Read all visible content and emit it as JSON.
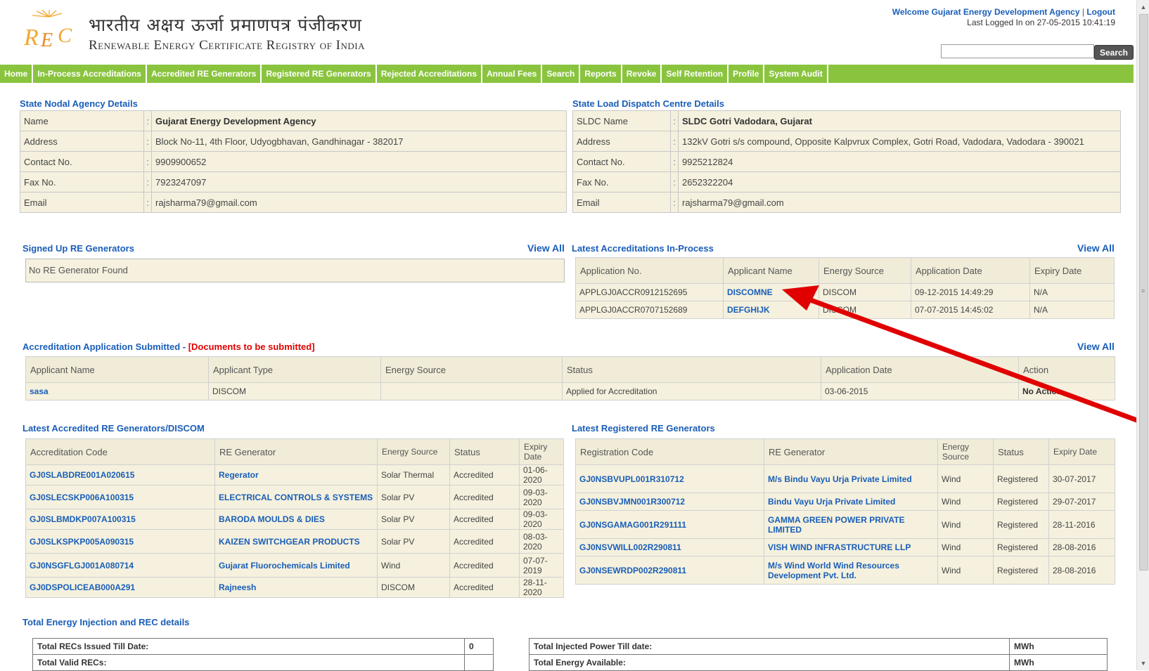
{
  "header": {
    "title_hi": "भारतीय अक्षय ऊर्जा प्रमाणपत्र पंजीकरण",
    "title_en": "Renewable Energy Certificate Registry of India",
    "welcome": "Welcome Gujarat Energy Development Agency",
    "separator": "|",
    "logout": "Logout",
    "last_logged": "Last Logged In on 27-05-2015 10:41:19",
    "search_value": "",
    "search_button": "Search"
  },
  "nav": [
    "Home",
    "In-Process Accreditations",
    "Accredited RE Generators",
    "Registered RE Generators",
    "Rejected Accreditations",
    "Annual Fees",
    "Search",
    "Reports",
    "Revoke",
    "Self Retention",
    "Profile",
    "System Audit"
  ],
  "state_nodal": {
    "title": "State Nodal Agency Details",
    "rows": [
      {
        "label": "Name",
        "sep": ":",
        "value": "Gujarat Energy Development Agency"
      },
      {
        "label": "Address",
        "sep": ":",
        "value": "Block No-11, 4th Floor, Udyogbhavan, Gandhinagar - 382017"
      },
      {
        "label": "Contact No.",
        "sep": ":",
        "value": "9909900652"
      },
      {
        "label": "Fax No.",
        "sep": ":",
        "value": "7923247097"
      },
      {
        "label": "Email",
        "sep": ":",
        "value": "rajsharma79@gmail.com"
      }
    ]
  },
  "sldc": {
    "title": "State Load Dispatch Centre Details",
    "rows": [
      {
        "label": "SLDC Name",
        "sep": ":",
        "value": "SLDC Gotri Vadodara, Gujarat"
      },
      {
        "label": "Address",
        "sep": ":",
        "value": "132kV Gotri s/s compound, Opposite Kalpvrux Complex, Gotri Road, Vadodara, Vadodara - 390021"
      },
      {
        "label": "Contact No.",
        "sep": ":",
        "value": "9925212824"
      },
      {
        "label": "Fax No.",
        "sep": ":",
        "value": "2652322204"
      },
      {
        "label": "Email",
        "sep": ":",
        "value": "rajsharma79@gmail.com"
      }
    ]
  },
  "signed_up": {
    "title": "Signed Up RE Generators",
    "view_all": "View All",
    "empty": "No RE Generator Found"
  },
  "latest_inprocess": {
    "title": "Latest Accreditations In-Process",
    "view_all": "View All",
    "headers": [
      "Application No.",
      "Applicant Name",
      "Energy Source",
      "Application Date",
      "Expiry Date"
    ],
    "rows": [
      [
        "APPLGJ0ACCR0912152695",
        "DISCOMNE",
        "DISCOM",
        "09-12-2015 14:49:29",
        "N/A"
      ],
      [
        "APPLGJ0ACCR0707152689",
        "DEFGHIJK",
        "DISCOM",
        "07-07-2015 14:45:02",
        "N/A"
      ]
    ]
  },
  "submitted": {
    "title": "Accreditation Application Submitted - ",
    "title_red": "[Documents to be submitted]",
    "view_all": "View All",
    "headers": [
      "Applicant Name",
      "Applicant Type",
      "Energy Source",
      "Status",
      "Application Date",
      "Action"
    ],
    "rows": [
      [
        "sasa",
        "DISCOM",
        "",
        "Applied for Accreditation",
        "03-06-2015",
        "No Action"
      ]
    ]
  },
  "accredited": {
    "title": "Latest Accredited RE Generators/DISCOM",
    "headers": [
      "Accreditation Code",
      "RE Generator",
      "Energy Source",
      "Status",
      "Expiry Date"
    ],
    "rows": [
      [
        "GJ0SLABDRE001A020615",
        "Regerator",
        "Solar Thermal",
        "Accredited",
        "01-06-2020"
      ],
      [
        "GJ0SLECSKP006A100315",
        "ELECTRICAL CONTROLS & SYSTEMS",
        "Solar PV",
        "Accredited",
        "09-03-2020"
      ],
      [
        "GJ0SLBMDKP007A100315",
        "BARODA MOULDS & DIES",
        "Solar PV",
        "Accredited",
        "09-03-2020"
      ],
      [
        "GJ0SLKSPKP005A090315",
        "KAIZEN SWITCHGEAR PRODUCTS",
        "Solar PV",
        "Accredited",
        "08-03-2020"
      ],
      [
        "GJ0NSGFLGJ001A080714",
        "Gujarat Fluorochemicals Limited",
        "Wind",
        "Accredited",
        "07-07-2019"
      ],
      [
        "GJ0DSPOLICEAB000A291",
        "Rajneesh",
        "DISCOM",
        "Accredited",
        "28-11-2020"
      ]
    ]
  },
  "registered": {
    "title": "Latest Registered RE Generators",
    "headers": [
      "Registration Code",
      "RE Generator",
      "Energy Source",
      "Status",
      "Expiry Date"
    ],
    "rows": [
      [
        "GJ0NSBVUPL001R310712",
        "M/s Bindu Vayu Urja Private Limited",
        "Wind",
        "Registered",
        "30-07-2017"
      ],
      [
        "GJ0NSBVJMN001R300712",
        "Bindu Vayu Urja Private Limited",
        "Wind",
        "Registered",
        "29-07-2017"
      ],
      [
        "GJ0NSGAMAG001R291111",
        "GAMMA GREEN POWER PRIVATE LIMITED",
        "Wind",
        "Registered",
        "28-11-2016"
      ],
      [
        "GJ0NSVWILL002R290811",
        "VISH WIND INFRASTRUCTURE LLP",
        "Wind",
        "Registered",
        "28-08-2016"
      ],
      [
        "GJ0NSEWRDP002R290811",
        "M/s Wind World Wind Resources Development Pvt. Ltd.",
        "Wind",
        "Registered",
        "28-08-2016"
      ]
    ]
  },
  "totals": {
    "title": "Total Energy Injection and REC details",
    "left": [
      {
        "label": "Total RECs Issued Till Date:",
        "value": "0"
      },
      {
        "label": "Total Valid RECs:",
        "value": ""
      }
    ],
    "right": [
      {
        "label": "Total Injected Power Till date:",
        "value": "MWh"
      },
      {
        "label": "Total Energy Available:",
        "value": "MWh"
      }
    ]
  },
  "colors": {
    "nav_green": "#8ac43f",
    "link_blue": "#1a5eb8",
    "arrow_red": "#e00000",
    "cell_beige": "#f5f1de"
  }
}
